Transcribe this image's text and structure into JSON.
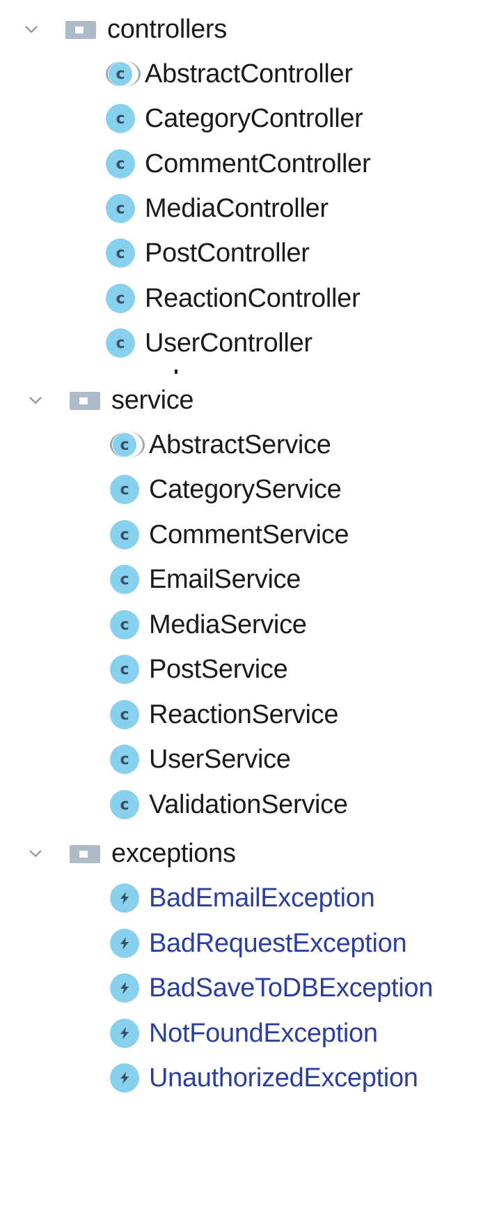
{
  "tree": {
    "folders": [
      {
        "name": "controllers",
        "items": [
          {
            "label": "AbstractController",
            "kind": "abstract-class"
          },
          {
            "label": "CategoryController",
            "kind": "class"
          },
          {
            "label": "CommentController",
            "kind": "class"
          },
          {
            "label": "MediaController",
            "kind": "class"
          },
          {
            "label": "PostController",
            "kind": "class"
          },
          {
            "label": "ReactionController",
            "kind": "class"
          },
          {
            "label": "UserController",
            "kind": "class"
          }
        ]
      },
      {
        "name": "service",
        "items": [
          {
            "label": "AbstractService",
            "kind": "abstract-class"
          },
          {
            "label": "CategoryService",
            "kind": "class"
          },
          {
            "label": "CommentService",
            "kind": "class"
          },
          {
            "label": "EmailService",
            "kind": "class"
          },
          {
            "label": "MediaService",
            "kind": "class"
          },
          {
            "label": "PostService",
            "kind": "class"
          },
          {
            "label": "ReactionService",
            "kind": "class"
          },
          {
            "label": "UserService",
            "kind": "class"
          },
          {
            "label": "ValidationService",
            "kind": "class"
          }
        ]
      },
      {
        "name": "exceptions",
        "items": [
          {
            "label": "BadEmailException",
            "kind": "exception"
          },
          {
            "label": "BadRequestException",
            "kind": "exception"
          },
          {
            "label": "BadSaveToDBException",
            "kind": "exception"
          },
          {
            "label": "NotFoundException",
            "kind": "exception"
          },
          {
            "label": "UnauthorizedException",
            "kind": "exception"
          }
        ]
      }
    ],
    "icons": {
      "chevron": "chevron-down-icon",
      "folder": "folder-icon",
      "class": "class-icon",
      "abstract-class": "abstract-class-icon",
      "exception": "exception-icon"
    },
    "colors": {
      "class_icon_bg": "#87d0ee",
      "folder_icon": "#aebbc8",
      "exception_text": "#2a3fa0",
      "text": "#1a1a1a"
    },
    "class_letter": "c"
  }
}
